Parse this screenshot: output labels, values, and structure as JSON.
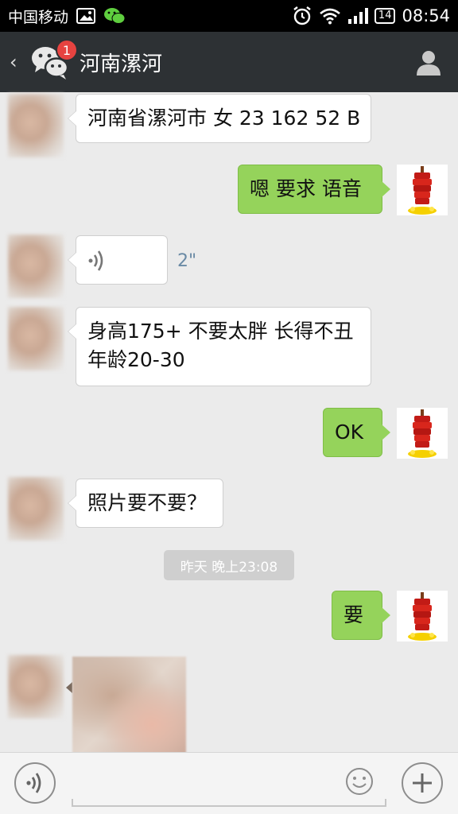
{
  "status_bar": {
    "carrier": "中国移动",
    "battery": "14",
    "time": "08:54"
  },
  "header": {
    "unread_badge": "1",
    "title": "河南漯河"
  },
  "messages": [
    {
      "side": "in",
      "type": "text",
      "text": "河南省漯河市 女 23 162 52 B"
    },
    {
      "side": "out",
      "type": "text",
      "text": "嗯  要求 语音"
    },
    {
      "side": "in",
      "type": "voice",
      "duration": "2\""
    },
    {
      "side": "in",
      "type": "text",
      "lines": [
        "身高175+ 不要太胖 长得不丑",
        "年龄20-30"
      ]
    },
    {
      "side": "out",
      "type": "text",
      "text": "OK"
    },
    {
      "side": "in",
      "type": "text",
      "text": "照片要不要？"
    },
    {
      "type": "timestamp",
      "text": "昨天 晚上23:08"
    },
    {
      "side": "out",
      "type": "text",
      "text": "要"
    },
    {
      "side": "in",
      "type": "image"
    }
  ],
  "colors": {
    "outgoing_bubble": "#95d35b",
    "incoming_bubble": "#ffffff",
    "title_bar": "#2d3134",
    "badge": "#e64340",
    "chat_bg": "#ebebeb"
  },
  "icons": {
    "status": [
      "image-icon",
      "wechat-icon",
      "alarm-icon",
      "wifi-icon",
      "signal-icon",
      "battery-icon"
    ],
    "header": [
      "back-chevron-icon",
      "wechat-logo-icon",
      "profile-icon"
    ],
    "input": [
      "voice-mode-icon",
      "emoji-icon",
      "plus-icon"
    ]
  }
}
